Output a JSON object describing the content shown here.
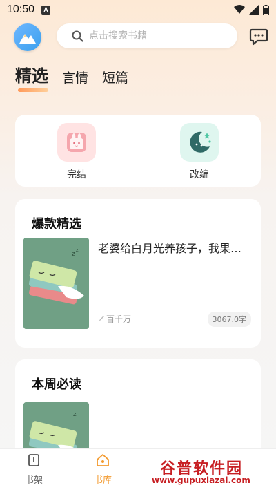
{
  "status_bar": {
    "time": "10:50",
    "indicator": "A"
  },
  "search": {
    "placeholder": "点击搜索书籍"
  },
  "tabs": [
    {
      "label": "精选",
      "active": true
    },
    {
      "label": "言情",
      "active": false
    },
    {
      "label": "短篇",
      "active": false
    }
  ],
  "categories": [
    {
      "label": "完结",
      "icon": "rabbit-book-icon",
      "color": "#ffe3e3"
    },
    {
      "label": "改编",
      "icon": "moon-stars-icon",
      "color": "#dff6ef"
    }
  ],
  "sections": {
    "hot": {
      "title": "爆款精选",
      "book": {
        "title": "老婆给白月光养孩子，我果断离婚",
        "author": "百千万",
        "words": "3067.0字"
      }
    },
    "weekly": {
      "title": "本周必读"
    }
  },
  "bottom_nav": [
    {
      "label": "书架",
      "active": false,
      "icon": "bookshelf-icon"
    },
    {
      "label": "书库",
      "active": true,
      "icon": "library-icon"
    }
  ],
  "watermark": {
    "text": "谷普软件园",
    "url": "www.gupuxlazal.com"
  },
  "colors": {
    "accent": "#f39a2e",
    "title_underline": "#ff9a5a",
    "background": "#f6f6f6"
  }
}
